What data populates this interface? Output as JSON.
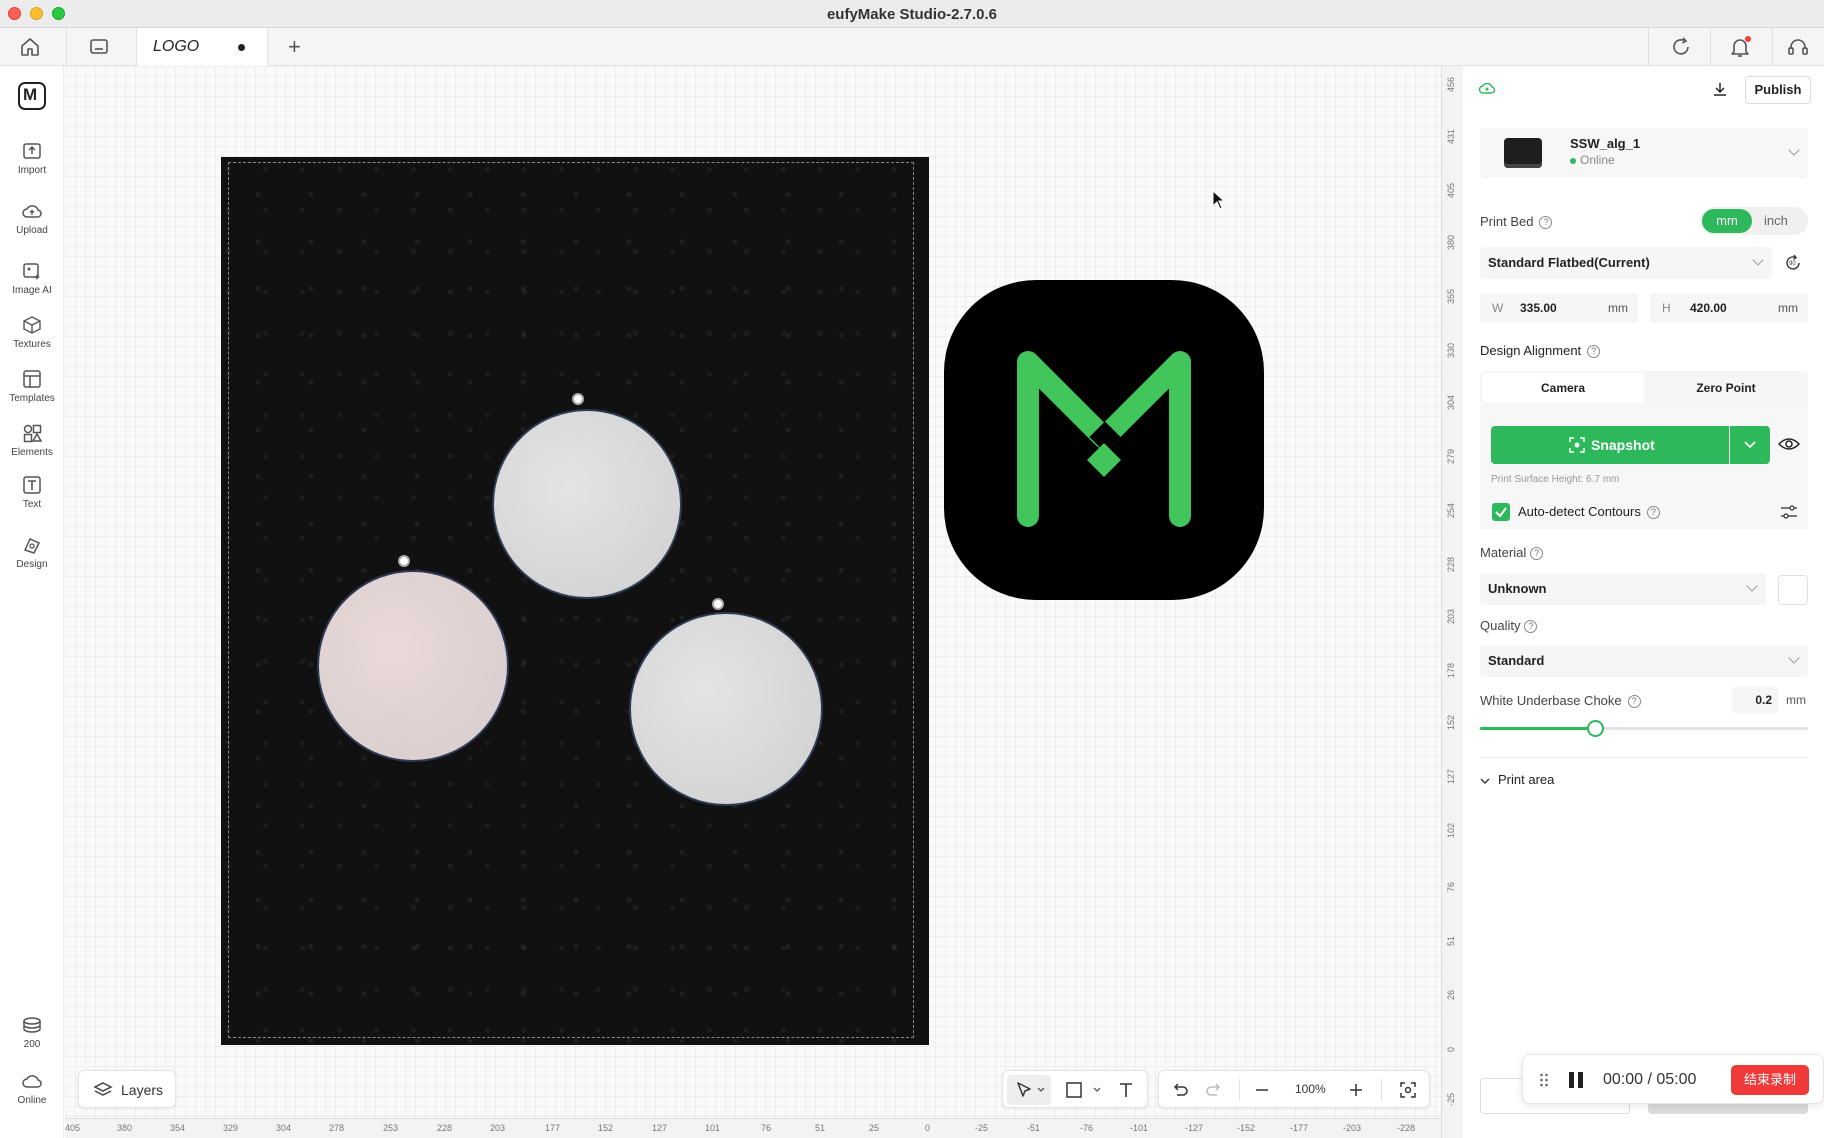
{
  "window": {
    "title": "eufyMake Studio-2.7.0.6"
  },
  "tabs": {
    "active_label": "LOGO",
    "add_label": "+"
  },
  "sidebar": {
    "items": [
      {
        "label": "Import"
      },
      {
        "label": "Upload"
      },
      {
        "label": "Image AI"
      },
      {
        "label": "Textures"
      },
      {
        "label": "Templates"
      },
      {
        "label": "Elements"
      },
      {
        "label": "Text"
      },
      {
        "label": "Design"
      }
    ],
    "bottom": [
      {
        "label": "200"
      },
      {
        "label": "Online"
      }
    ]
  },
  "rulers": {
    "bottom": [
      "405",
      "380",
      "354",
      "329",
      "304",
      "278",
      "253",
      "228",
      "203",
      "177",
      "152",
      "127",
      "101",
      "76",
      "51",
      "25",
      "0",
      "-25",
      "-51",
      "-76",
      "-101",
      "-127",
      "-152",
      "-177",
      "-203",
      "-228"
    ],
    "right": [
      "456",
      "431",
      "405",
      "380",
      "355",
      "330",
      "304",
      "279",
      "254",
      "228",
      "203",
      "178",
      "152",
      "127",
      "102",
      "76",
      "51",
      "26",
      "0",
      "-25"
    ]
  },
  "canvas": {
    "layers_label": "Layers",
    "zoom": "100%"
  },
  "panel": {
    "publish_label": "Publish",
    "device": {
      "name": "SSW_alg_1",
      "status": "Online"
    },
    "print_bed": {
      "label": "Print Bed",
      "unit_mm": "mm",
      "unit_inch": "inch",
      "bed_type": "Standard Flatbed(Current)",
      "w_key": "W",
      "w_value": "335.00",
      "w_unit": "mm",
      "h_key": "H",
      "h_value": "420.00",
      "h_unit": "mm"
    },
    "alignment": {
      "label": "Design Alignment",
      "camera": "Camera",
      "zero_point": "Zero Point",
      "snapshot": "Snapshot",
      "surface_height": "Print Surface Height: 6.7 mm",
      "auto_detect": "Auto-detect Contours"
    },
    "material": {
      "label": "Material",
      "value": "Unknown"
    },
    "quality": {
      "label": "Quality",
      "value": "Standard"
    },
    "choke": {
      "label": "White Underbase Choke",
      "value": "0.2",
      "unit": "mm",
      "level": 0.35
    },
    "print_area": {
      "label": "Print area"
    }
  },
  "recording": {
    "time": "00:00  /  05:00",
    "stop_label": "结束录制"
  },
  "colors": {
    "accent": "#2eb85c",
    "record": "#f03a3a"
  }
}
